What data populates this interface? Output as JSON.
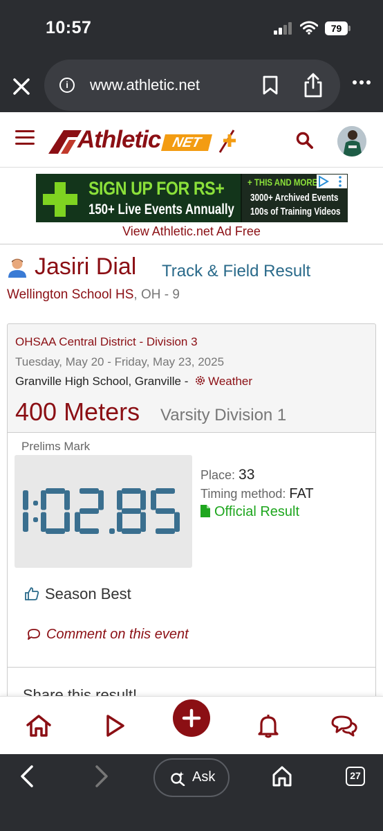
{
  "status_bar": {
    "time": "10:57",
    "battery": "79"
  },
  "browser": {
    "url": "www.athletic.net",
    "ask_label": "Ask",
    "tab_count": "27"
  },
  "site": {
    "logo_text": "Athletic",
    "logo_net": "NET"
  },
  "ad": {
    "headline": "SIGN UP FOR RS+",
    "subline": "150+ Live Events Annually",
    "right_line1": "+ THIS AND MORE",
    "right_line2": "3000+ Archived Events",
    "right_line3": "100s of Training Videos",
    "ad_free_link": "View Athletic.net Ad Free"
  },
  "athlete": {
    "name": "Jasiri Dial",
    "result_type": "Track & Field Result",
    "school": "Wellington School HS",
    "school_suffix": ", OH - 9"
  },
  "meet": {
    "name": "OHSAA Central District - Division 3",
    "dates": "Tuesday, May 20 - Friday, May 23, 2025",
    "venue": "Granville High School, Granville - ",
    "weather_link": "Weather"
  },
  "event": {
    "name": "400 Meters",
    "division": "Varsity Division 1"
  },
  "result": {
    "prelims_label": "Prelims Mark",
    "time": "1:02.85",
    "place_label": "Place:",
    "place": "33",
    "timing_label": "Timing method:",
    "timing_value": "FAT",
    "official_label": "Official Result",
    "season_best": "Season Best",
    "comment_link": "Comment on this event",
    "share_label": "Share this result!"
  },
  "colors": {
    "brand": "#8b0f14",
    "link_blue": "#2a6a8a",
    "official_green": "#1ea61e",
    "timer_digits": "#3a6f8f"
  }
}
